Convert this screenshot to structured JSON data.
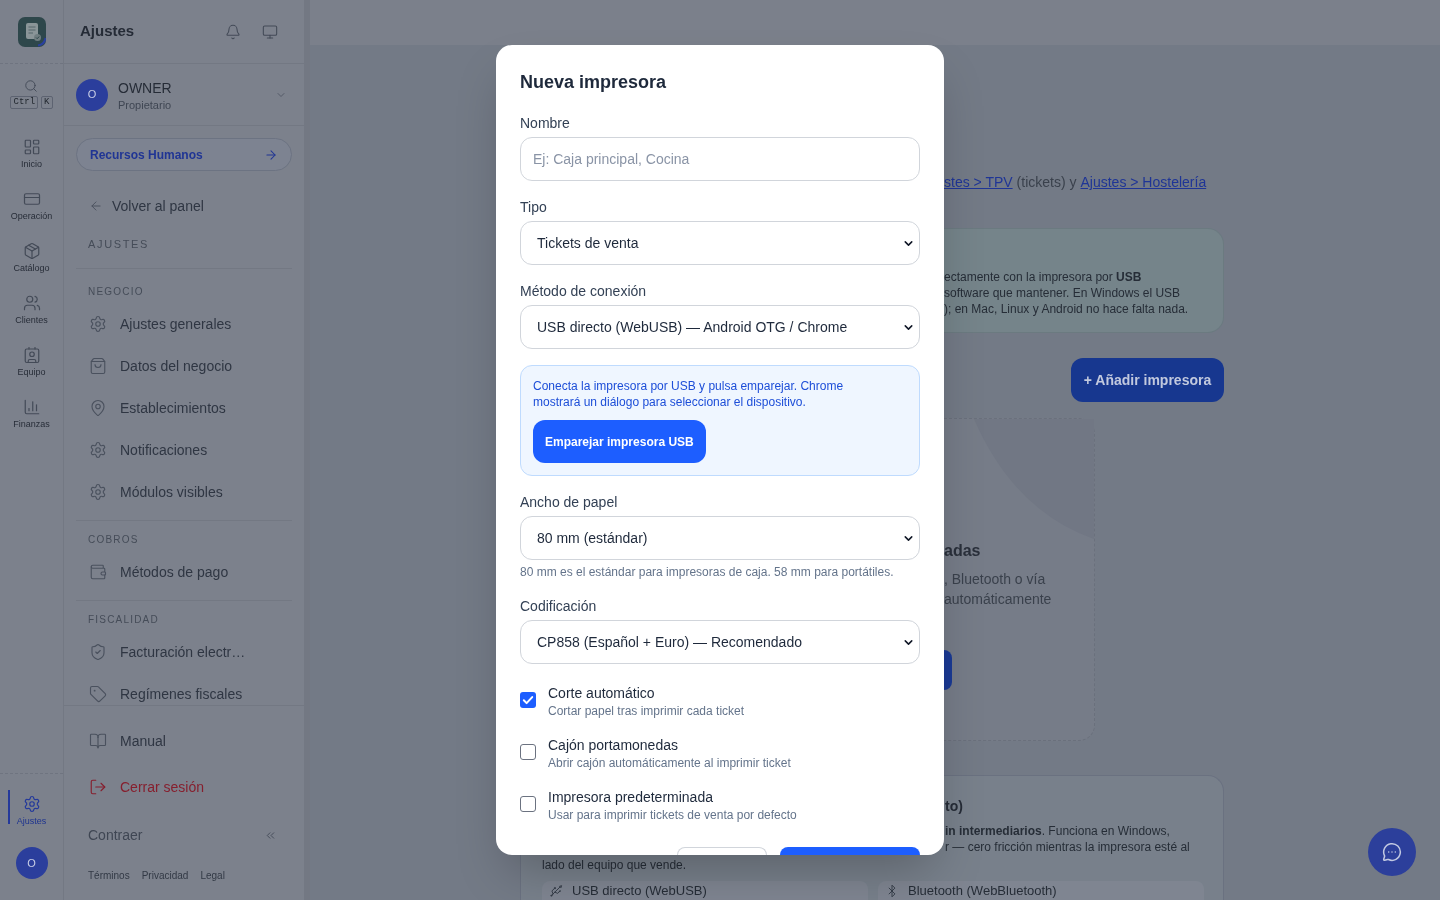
{
  "rail": {
    "search_shortcut": [
      "Ctrl",
      "K"
    ],
    "items": [
      {
        "label": "Inicio",
        "selected": false
      },
      {
        "label": "Operación",
        "selected": false
      },
      {
        "label": "Catálogo",
        "selected": false
      },
      {
        "label": "Clientes",
        "selected": false
      },
      {
        "label": "Equipo",
        "selected": false
      },
      {
        "label": "Finanzas",
        "selected": false
      }
    ],
    "footer_items": [
      {
        "label": "Ajustes",
        "selected": true
      }
    ],
    "avatar": "O"
  },
  "sidebar": {
    "title": "Ajustes",
    "user": {
      "avatar": "O",
      "name": "OWNER",
      "role": "Propietario"
    },
    "hr_link": "Recursos Humanos",
    "back_link": "Volver al panel",
    "heading": "AJUSTES",
    "sections": [
      {
        "title": "NEGOCIO",
        "items": [
          "Ajustes generales",
          "Datos del negocio",
          "Establecimientos",
          "Notificaciones",
          "Módulos visibles"
        ]
      },
      {
        "title": "COBROS",
        "items": [
          "Métodos de pago"
        ]
      },
      {
        "title": "FISCALIDAD",
        "items": [
          "Facturación electr…",
          "Regímenes fiscales"
        ]
      }
    ],
    "footer_items": [
      {
        "label": "Manual",
        "kind": "normal"
      },
      {
        "label": "Cerrar sesión",
        "kind": "danger"
      }
    ],
    "collapse": "Contraer",
    "legal_links": [
      "Términos",
      "Privacidad",
      "Legal"
    ]
  },
  "main": {
    "links_line": [
      {
        "kind": "link",
        "text": "stes > TPV"
      },
      {
        "kind": "plain",
        "text": "(tickets) y"
      },
      {
        "kind": "link",
        "text": "Ajustes > Hostelería"
      }
    ],
    "usb_card": {
      "lines": [
        "ectamente con la impresora por **USB**",
        "software que mantener. En Windows el USB",
        "); en Mac, Linux y Android no hace falta nada."
      ]
    },
    "add_button": "+ Añadir impresora",
    "empty_state": {
      "title": "adas",
      "lines": [
        ", Bluetooth o vía",
        "automáticamente"
      ]
    },
    "info_card": {
      "title": "to)",
      "lines": [
        "**in intermediarios**. Funciona en Windows,",
        "r — cero fricción mientras la impresora esté al"
      ],
      "last_line": "lado del equipo que vende.",
      "methods": [
        "USB directo (WebUSB)",
        "Bluetooth (WebBluetooth)"
      ]
    }
  },
  "modal": {
    "title": "Nueva impresora",
    "fields": [
      {
        "kind": "text",
        "label": "Nombre",
        "placeholder": "Ej: Caja principal, Cocina"
      },
      {
        "kind": "select",
        "label": "Tipo",
        "value": "Tickets de venta"
      },
      {
        "kind": "select",
        "label": "Método de conexión",
        "value": "USB directo (WebUSB) — Android OTG / Chrome"
      },
      {
        "kind": "notice",
        "text": "Conecta la impresora por USB y pulsa emparejar. Chrome mostrará un diálogo para seleccionar el dispositivo.",
        "button": "Emparejar impresora USB"
      },
      {
        "kind": "select",
        "label": "Ancho de papel",
        "value": "80 mm (estándar)",
        "hint": "80 mm es el estándar para impresoras de caja. 58 mm para portátiles."
      },
      {
        "kind": "select",
        "label": "Codificación",
        "value": "CP858 (Español + Euro) — Recomendado"
      }
    ],
    "options": [
      {
        "label": "Corte automático",
        "description": "Cortar papel tras imprimir cada ticket",
        "checked": true
      },
      {
        "label": "Cajón portamonedas",
        "description": "Abrir cajón automáticamente al imprimir ticket",
        "checked": false
      },
      {
        "label": "Impresora predeterminada",
        "description": "Usar para imprimir tickets de venta por defecto",
        "checked": false
      }
    ]
  }
}
